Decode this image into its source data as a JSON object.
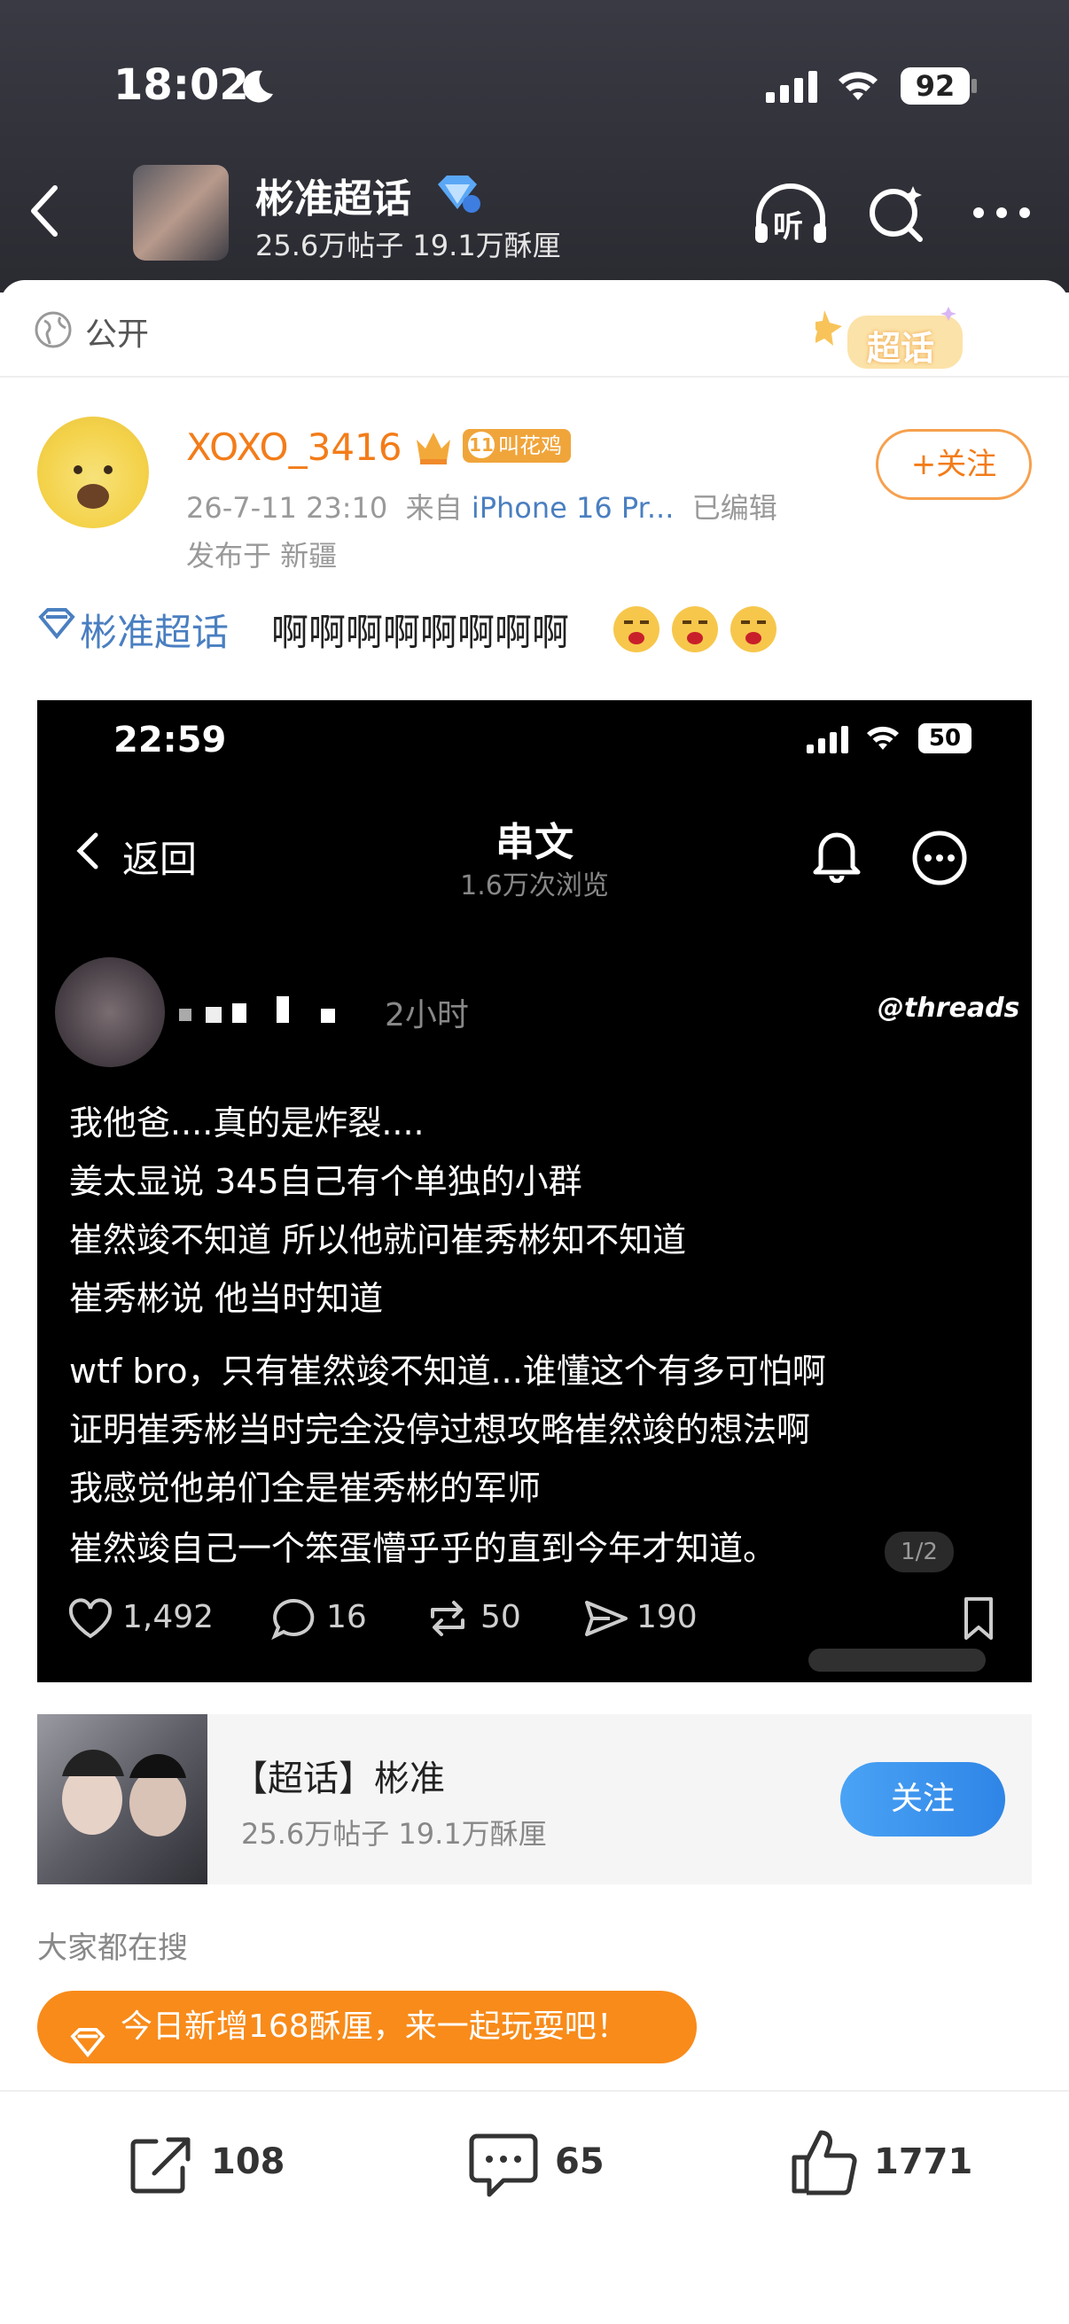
{
  "status_bar": {
    "time": "18:02",
    "battery": "92"
  },
  "header": {
    "title": "彬准超话",
    "stats": "25.6万帖子 19.1万酥厘",
    "listen_label": "听"
  },
  "visibility": {
    "label": "公开",
    "badge": "超话"
  },
  "post": {
    "username": "XOXO_3416",
    "level_badge": "11",
    "level_name": "叫花鸡",
    "meta": "26-7-11 23:10",
    "source_prefix": "来自",
    "device": "iPhone 16 Pr...",
    "edited": "已编辑",
    "location": "发布于 新疆",
    "follow_label": "+关注",
    "topic_link": "彬准超话",
    "text": "啊啊啊啊啊啊啊啊"
  },
  "screenshot": {
    "time": "22:59",
    "battery": "50",
    "back_label": "返回",
    "title": "串文",
    "views": "1.6万次浏览",
    "post_time": "2小时",
    "threads_logo": "threads",
    "lines": [
      "我他爸....真的是炸裂....",
      "姜太显说 345自己有个单独的小群",
      "崔然竣不知道 所以他就问崔秀彬知不知道",
      "崔秀彬说 他当时知道",
      "wtf bro，只有崔然竣不知道...谁懂这个有多可怕啊",
      "证明崔秀彬当时完全没停过想攻略崔然竣的想法啊",
      "我感觉他弟们全是崔秀彬的军师",
      "崔然竣自己一个笨蛋懵乎乎的直到今年才知道。"
    ],
    "page_indicator": "1/2",
    "likes": "1,492",
    "comments": "16",
    "reposts": "50",
    "shares": "190"
  },
  "topic_card": {
    "name": "【超话】彬准",
    "stats": "25.6万帖子 19.1万酥厘",
    "follow_label": "关注"
  },
  "search_label": "大家都在搜",
  "promo": "今日新增168酥厘，来一起玩耍吧！",
  "bottom_bar": {
    "shares": "108",
    "comments": "65",
    "likes": "1771"
  },
  "colors": {
    "accent_orange": "#f88b1a",
    "username_orange": "#f37c19",
    "link_blue": "#4a7fc1",
    "follow_blue": "#3b8fef"
  }
}
